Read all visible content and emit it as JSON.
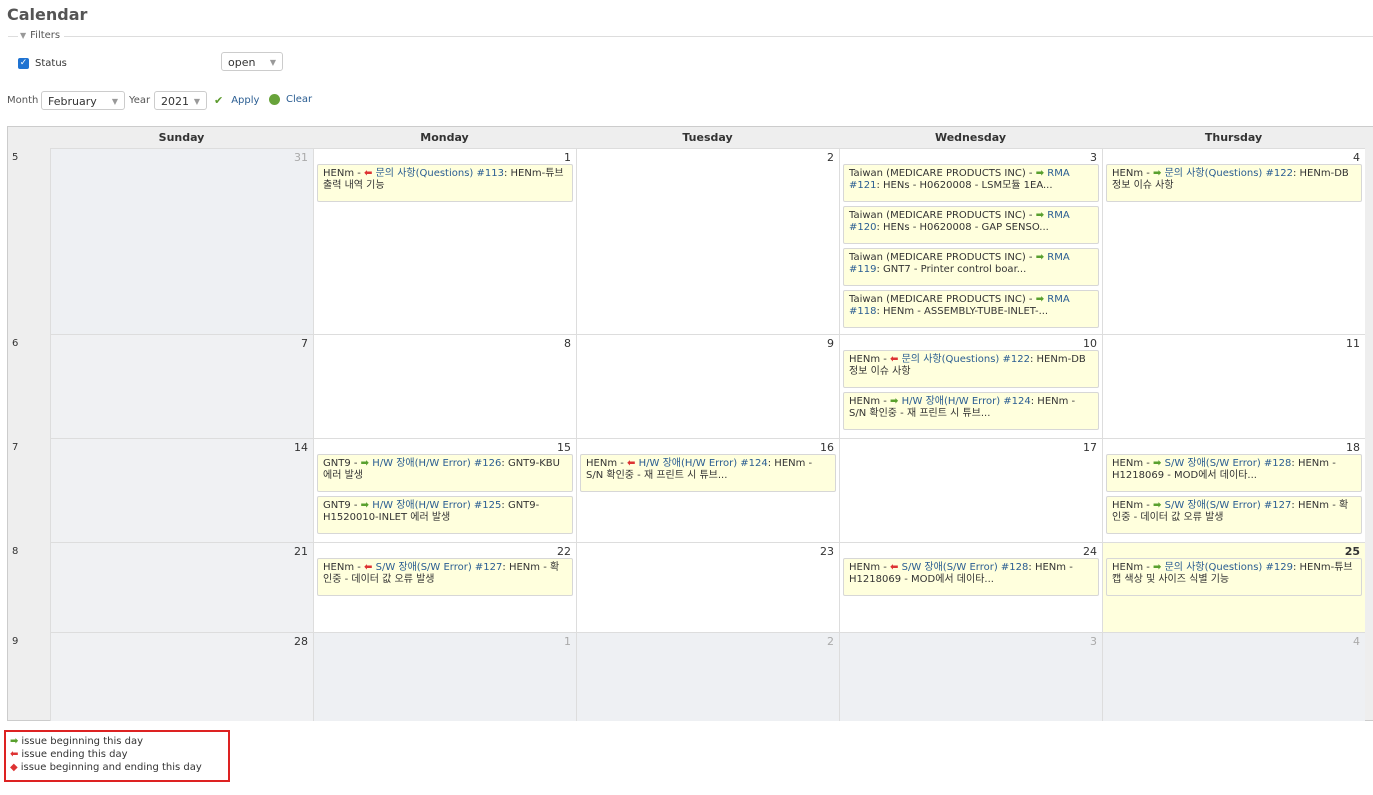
{
  "page": {
    "title": "Calendar"
  },
  "filters": {
    "legend": "Filters",
    "status_label": "Status",
    "status_value": "open",
    "month_label": "Month",
    "month_value": "February",
    "year_label": "Year",
    "year_value": "2021",
    "apply_label": "Apply",
    "clear_label": "Clear"
  },
  "calendar": {
    "days": [
      "Sunday",
      "Monday",
      "Tuesday",
      "Wednesday",
      "Thursday"
    ],
    "weeks": [
      {
        "num": "5",
        "days": [
          {
            "n": "31",
            "other": true,
            "issues": []
          },
          {
            "n": "1",
            "issues": [
              {
                "pre": "HENm - ",
                "mark": "end",
                "tracker": "문의 사항(Questions) #113",
                "rest": ": HENm-튜브 출력 내역 기능"
              }
            ]
          },
          {
            "n": "2",
            "issues": []
          },
          {
            "n": "3",
            "issues": [
              {
                "pre": "Taiwan (MEDICARE PRODUCTS INC) - ",
                "mark": "start",
                "tracker": "RMA #121",
                "rest": ": HENs - H0620008 - LSM모듈 1EA..."
              },
              {
                "pre": "Taiwan (MEDICARE PRODUCTS INC) - ",
                "mark": "start",
                "tracker": "RMA #120",
                "rest": ": HENs - H0620008 - GAP SENSO..."
              },
              {
                "pre": "Taiwan (MEDICARE PRODUCTS INC) - ",
                "mark": "start",
                "tracker": "RMA #119",
                "rest": ": GNT7 - Printer control boar..."
              },
              {
                "pre": "Taiwan (MEDICARE PRODUCTS INC) - ",
                "mark": "start",
                "tracker": "RMA #118",
                "rest": ": HENm - ASSEMBLY-TUBE-INLET-..."
              }
            ]
          },
          {
            "n": "4",
            "issues": [
              {
                "pre": "HENm - ",
                "mark": "start",
                "tracker": "문의 사항(Questions) #122",
                "rest": ": HENm-DB 정보 이슈 사항"
              }
            ]
          }
        ]
      },
      {
        "num": "6",
        "days": [
          {
            "n": "7",
            "issues": []
          },
          {
            "n": "8",
            "issues": []
          },
          {
            "n": "9",
            "issues": []
          },
          {
            "n": "10",
            "issues": [
              {
                "pre": "HENm - ",
                "mark": "end",
                "tracker": "문의 사항(Questions) #122",
                "rest": ": HENm-DB 정보 이슈 사항"
              },
              {
                "pre": "HENm - ",
                "mark": "start",
                "tracker": "H/W 장애(H/W Error) #124",
                "rest": ": HENm - S/N 확인중 - 재 프린트 시 튜브..."
              }
            ]
          },
          {
            "n": "11",
            "issues": []
          }
        ]
      },
      {
        "num": "7",
        "days": [
          {
            "n": "14",
            "issues": []
          },
          {
            "n": "15",
            "issues": [
              {
                "pre": "GNT9 - ",
                "mark": "start",
                "tracker": "H/W 장애(H/W Error) #126",
                "rest": ": GNT9-KBU 에러 발생"
              },
              {
                "pre": "GNT9 - ",
                "mark": "start",
                "tracker": "H/W 장애(H/W Error) #125",
                "rest": ": GNT9-H1520010-INLET 에러 발생"
              }
            ]
          },
          {
            "n": "16",
            "issues": [
              {
                "pre": "HENm - ",
                "mark": "end",
                "tracker": "H/W 장애(H/W Error) #124",
                "rest": ": HENm - S/N 확인중 - 재 프린트 시 튜브..."
              }
            ]
          },
          {
            "n": "17",
            "issues": []
          },
          {
            "n": "18",
            "issues": [
              {
                "pre": "HENm - ",
                "mark": "start",
                "tracker": "S/W 장애(S/W Error) #128",
                "rest": ": HENm - H1218069 - MOD에서 데이타..."
              },
              {
                "pre": "HENm - ",
                "mark": "start",
                "tracker": "S/W 장애(S/W Error) #127",
                "rest": ": HENm - 확인중 - 데이터 값 오류 발생"
              }
            ]
          }
        ]
      },
      {
        "num": "8",
        "days": [
          {
            "n": "21",
            "issues": []
          },
          {
            "n": "22",
            "issues": [
              {
                "pre": "HENm - ",
                "mark": "end",
                "tracker": "S/W 장애(S/W Error) #127",
                "rest": ": HENm - 확인중 - 데이터 값 오류 발생"
              }
            ]
          },
          {
            "n": "23",
            "issues": []
          },
          {
            "n": "24",
            "issues": [
              {
                "pre": "HENm - ",
                "mark": "end",
                "tracker": "S/W 장애(S/W Error) #128",
                "rest": ": HENm - H1218069 - MOD에서 데이타..."
              }
            ]
          },
          {
            "n": "25",
            "today": true,
            "issues": [
              {
                "pre": "HENm - ",
                "mark": "start",
                "tracker": "문의 사항(Questions) #129",
                "rest": ": HENm-튜브 캡 색상 및 사이즈 식별 기능"
              }
            ]
          }
        ]
      },
      {
        "num": "9",
        "days": [
          {
            "n": "28",
            "issues": []
          },
          {
            "n": "1",
            "other": true,
            "issues": []
          },
          {
            "n": "2",
            "other": true,
            "issues": []
          },
          {
            "n": "3",
            "other": true,
            "issues": []
          },
          {
            "n": "4",
            "other": true,
            "issues": []
          }
        ]
      }
    ]
  },
  "legend": {
    "begin": "issue beginning this day",
    "end": "issue ending this day",
    "both": "issue beginning and ending this day"
  },
  "colors": {
    "accent_link": "#2a5d92",
    "issue_bg": "#ffffdd",
    "legend_border": "#dd2222"
  }
}
